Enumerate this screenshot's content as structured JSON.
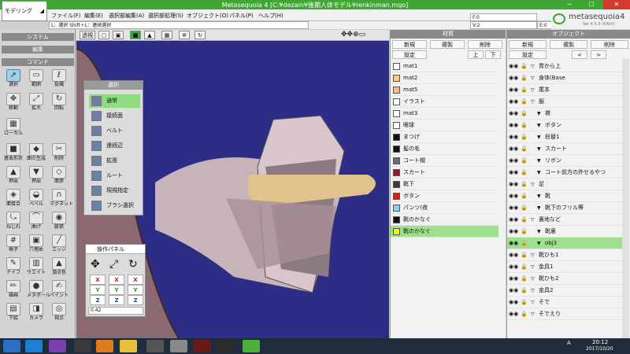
{
  "window": {
    "title": "Metasequoia 4 [C:¥dezain¥後期人体モデル¥renkinman.mqo]",
    "minimize": "─",
    "maximize": "☐",
    "close": "✕"
  },
  "mode": {
    "label": "モデリング"
  },
  "menu": [
    "ファイル(F)",
    "編集(E)",
    "選択部編集(A)",
    "選択部処理(S)",
    "オブジェクト(O)",
    "パネル(P)",
    "ヘルプ(H)"
  ],
  "status": {
    "hint": "L：選択 Shift＋L：連続選択",
    "f": "F:0",
    "v": "V:2",
    "e": "E:0",
    "logo": "metasequoia4",
    "version": "Ver 4.5.9 (64bit)"
  },
  "left": {
    "system": "システム",
    "edit": "編集",
    "command": "コマンド",
    "tools": [
      {
        "label": "選択",
        "icon": "cursor-icon",
        "g": "➚",
        "sel": true
      },
      {
        "label": "範囲",
        "icon": "rect-select-icon",
        "g": "▭"
      },
      {
        "label": "投縄",
        "icon": "lasso-icon",
        "g": "ℓ"
      },
      {
        "label": "移動",
        "icon": "move-icon",
        "g": "✥"
      },
      {
        "label": "拡大",
        "icon": "scale-icon",
        "g": "⤢"
      },
      {
        "label": "回転",
        "icon": "rotate-icon",
        "g": "↻"
      },
      {
        "label": "ローカル",
        "icon": "local-icon",
        "g": "▦"
      },
      {
        "label": "基本形状",
        "icon": "primitive-icon",
        "g": "■"
      },
      {
        "label": "面の生成",
        "icon": "face-icon",
        "g": "◆"
      },
      {
        "label": "削除",
        "icon": "delete-icon",
        "g": "✂"
      },
      {
        "label": "押出",
        "icon": "extrude-icon",
        "g": "▲"
      },
      {
        "label": "押出",
        "icon": "push-icon",
        "g": "▼"
      },
      {
        "label": "面張",
        "icon": "bridge-icon",
        "g": "◇"
      },
      {
        "label": "面接合",
        "icon": "weld-icon",
        "g": "◈"
      },
      {
        "label": "ベベル",
        "icon": "bevel-icon",
        "g": "◒"
      },
      {
        "label": "マグネット",
        "icon": "magnet-icon",
        "g": "∩"
      },
      {
        "label": "ねじれ",
        "icon": "twist-icon",
        "g": "⤿"
      },
      {
        "label": "曲げ",
        "icon": "bend-icon",
        "g": "⌒"
      },
      {
        "label": "膨張",
        "icon": "inflate-icon",
        "g": "◉"
      },
      {
        "label": "格子",
        "icon": "lattice-icon",
        "g": "#"
      },
      {
        "label": "穴埋め",
        "icon": "fill-icon",
        "g": "▣"
      },
      {
        "label": "エッジ",
        "icon": "edge-icon",
        "g": "╱"
      },
      {
        "label": "ナイフ",
        "icon": "knife-icon",
        "g": "✎"
      },
      {
        "label": "ウエイト",
        "icon": "weight-icon",
        "g": "▥"
      },
      {
        "label": "頂点色",
        "icon": "vertex-color-icon",
        "g": "▲"
      },
      {
        "label": "描画",
        "icon": "paint-icon",
        "g": "✏"
      },
      {
        "label": "メタボール",
        "icon": "metaball-icon",
        "g": "●"
      },
      {
        "label": "ペイント",
        "icon": "brush-icon",
        "g": "✍"
      },
      {
        "label": "下絵",
        "icon": "underlay-icon",
        "g": "▤"
      },
      {
        "label": "カメラ",
        "icon": "camera-icon",
        "g": "◨"
      },
      {
        "label": "視点",
        "icon": "view-icon",
        "g": "◎"
      }
    ]
  },
  "viewtool": {
    "persp": "透視"
  },
  "sel": {
    "title": "選択",
    "items": [
      {
        "label": "通常",
        "on": true
      },
      {
        "label": "接続面"
      },
      {
        "label": "ベルト"
      },
      {
        "label": "連続辺"
      },
      {
        "label": "拡張"
      },
      {
        "label": "ルート"
      },
      {
        "label": "現視指定"
      },
      {
        "label": "ブラシ選択"
      }
    ]
  },
  "op": {
    "title": "操作パネル",
    "xyz": [
      "X",
      "X",
      "X",
      "Y",
      "Y",
      "Y",
      "Z",
      "Z",
      "Z"
    ],
    "value": "0.42"
  },
  "mat": {
    "title": "材質",
    "new": "新規",
    "dup": "複製",
    "del": "削除",
    "set": "設定",
    "up": "上",
    "down": "下",
    "rows": [
      {
        "n": "mat1",
        "c": "#ffffff"
      },
      {
        "n": "mat2",
        "c": "#f4cf8c"
      },
      {
        "n": "mat5",
        "c": "#f2c07a"
      },
      {
        "n": "イラスト",
        "c": "#ffffff"
      },
      {
        "n": "mat3",
        "c": "#ffffff"
      },
      {
        "n": "眼球",
        "c": "#ffffff"
      },
      {
        "n": "まつげ",
        "c": "#111111"
      },
      {
        "n": "髪の毛",
        "c": "#111111"
      },
      {
        "n": "コート帽",
        "c": "#6a6a7a"
      },
      {
        "n": "スカート",
        "c": "#8a2030"
      },
      {
        "n": "靴下",
        "c": "#3a3a3a"
      },
      {
        "n": "ボタン",
        "c": "#d02020"
      },
      {
        "n": "パンツ(夜",
        "c": "#88d4ee"
      },
      {
        "n": "靴のかなぐ",
        "c": "#111111"
      },
      {
        "n": "靴のかなぐ",
        "c": "#f6ee20",
        "on": true
      }
    ]
  },
  "obj": {
    "title": "オブジェクト",
    "new": "新規",
    "dup": "複製",
    "del": "削除",
    "set": "設定",
    "prev": "<",
    "next": ">",
    "rows": [
      {
        "n": "胃から上",
        "d": 0
      },
      {
        "n": "身体(Base",
        "d": 0
      },
      {
        "n": "尾本",
        "d": 0
      },
      {
        "n": "服",
        "d": 0
      },
      {
        "n": "襟",
        "d": 1
      },
      {
        "n": "ボタン",
        "d": 1
      },
      {
        "n": "段替1",
        "d": 1
      },
      {
        "n": "スカート",
        "d": 1
      },
      {
        "n": "リボン",
        "d": 1
      },
      {
        "n": "コート前方の外せるやつ",
        "d": 1
      },
      {
        "n": "足",
        "d": 0
      },
      {
        "n": "靴",
        "d": 1
      },
      {
        "n": "靴下のフリル等",
        "d": 1
      },
      {
        "n": "裏地など",
        "d": 0
      },
      {
        "n": "靴裏",
        "d": 1
      },
      {
        "n": "obj3",
        "d": 1,
        "on": true
      },
      {
        "n": "靴ひも1",
        "d": 0
      },
      {
        "n": "金具1",
        "d": 0
      },
      {
        "n": "靴ひも2",
        "d": 0
      },
      {
        "n": "金具2",
        "d": 0
      },
      {
        "n": "そで",
        "d": 0
      },
      {
        "n": "そでえり",
        "d": 0
      }
    ]
  },
  "taskbar": {
    "time": "20:12",
    "date": "2017/10/20",
    "lang": "A"
  }
}
